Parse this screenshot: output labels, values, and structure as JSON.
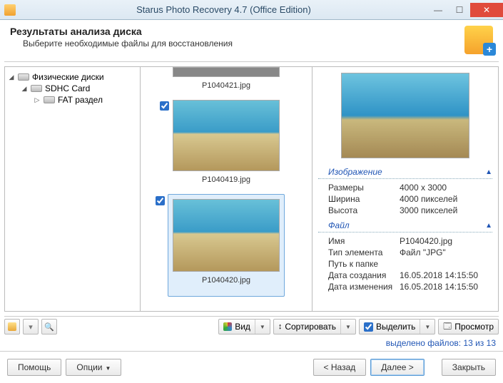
{
  "window": {
    "title": "Starus Photo Recovery 4.7 (Office Edition)"
  },
  "header": {
    "title": "Результаты анализа диска",
    "subtitle": "Выберите необходимые файлы для восстановления"
  },
  "tree": {
    "root": "Физические диски",
    "node1": "SDHC Card",
    "node2": "FAT раздел"
  },
  "thumbs": [
    {
      "file": "P1040421.jpg",
      "checked": false
    },
    {
      "file": "P1040419.jpg",
      "checked": true
    },
    {
      "file": "P1040420.jpg",
      "checked": true,
      "selected": true
    }
  ],
  "details": {
    "section_image": "Изображение",
    "section_file": "Файл",
    "dims_key": "Размеры",
    "dims_val": "4000 x 3000",
    "width_key": "Ширина",
    "width_val": "4000 пикселей",
    "height_key": "Высота",
    "height_val": "3000 пикселей",
    "name_key": "Имя",
    "name_val": "P1040420.jpg",
    "type_key": "Тип элемента",
    "type_val": "Файл \"JPG\"",
    "path_key": "Путь к папке",
    "path_val": "",
    "created_key": "Дата создания",
    "created_val": "16.05.2018 14:15:50",
    "modified_key": "Дата изменения",
    "modified_val": "16.05.2018 14:15:50"
  },
  "toolbar": {
    "view": "Вид",
    "sort": "Сортировать",
    "select": "Выделить",
    "preview": "Просмотр"
  },
  "status": {
    "label": "выделено файлов:",
    "value": "13 из 13"
  },
  "footer": {
    "help": "Помощь",
    "options": "Опции",
    "back": "< Назад",
    "next": "Далее >",
    "close": "Закрыть"
  }
}
